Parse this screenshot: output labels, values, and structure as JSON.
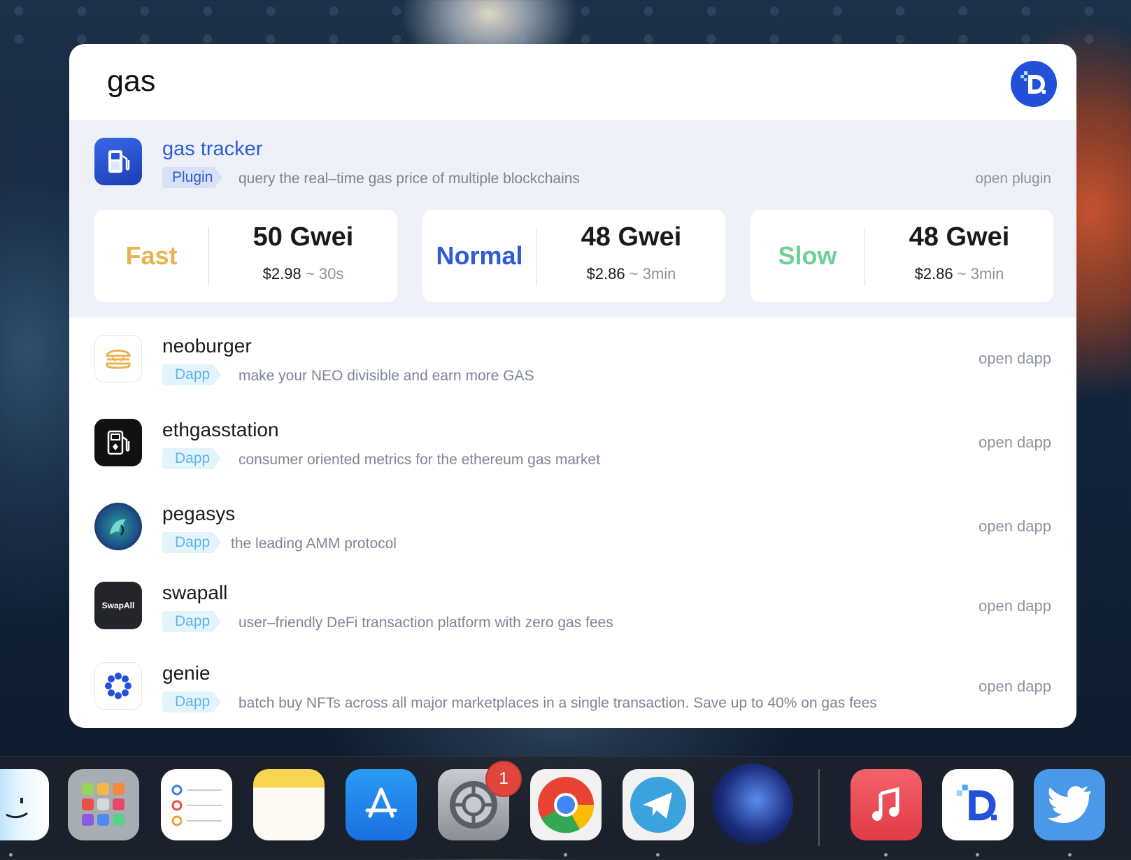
{
  "search": {
    "query": "gas"
  },
  "featured": {
    "title": "gas tracker",
    "badge": "Plugin",
    "description": "query the real–time gas price of multiple blockchains",
    "action": "open plugin",
    "cards": [
      {
        "speed": "Fast",
        "gwei": "50 Gwei",
        "price": "$2.98",
        "sep": "~",
        "time": "30s",
        "color": "#e8b252"
      },
      {
        "speed": "Normal",
        "gwei": "48 Gwei",
        "price": "$2.86",
        "sep": "~",
        "time": "3min",
        "color": "#2d5bd9"
      },
      {
        "speed": "Slow",
        "gwei": "48 Gwei",
        "price": "$2.86",
        "sep": "~",
        "time": "3min",
        "color": "#6fcf97"
      }
    ]
  },
  "results": [
    {
      "title": "neoburger",
      "badge": "Dapp",
      "description": "make your NEO divisible and earn more GAS",
      "action": "open dapp",
      "icon": "burger-icon"
    },
    {
      "title": "ethgasstation",
      "badge": "Dapp",
      "description": "consumer oriented metrics for the ethereum gas market",
      "action": "open dapp",
      "icon": "gas-pump-icon"
    },
    {
      "title": "pegasys",
      "badge": "Dapp",
      "description": "the leading AMM protocol",
      "action": "open dapp",
      "icon": "pegasus-icon"
    },
    {
      "title": "swapall",
      "badge": "Dapp",
      "description": "user–friendly DeFi transaction platform with zero gas fees",
      "action": "open dapp",
      "icon": "swapall-logo",
      "icon_text": "SwapAll"
    },
    {
      "title": "genie",
      "badge": "Dapp",
      "description": "batch buy NFTs across all major marketplaces in a single transaction. Save up to 40% on gas fees",
      "action": "open dapp",
      "icon": "genie-icon"
    }
  ],
  "dock": {
    "apps": [
      "finder",
      "launchpad",
      "reminders",
      "notes",
      "app-store",
      "system-preferences",
      "chrome",
      "telegram",
      "cinema4d",
      "music",
      "dapp-launcher",
      "twitter"
    ],
    "settings_badge": "1"
  },
  "colors": {
    "accent": "#2d5bd9",
    "fast": "#e8b252",
    "slow": "#6fcf97",
    "dapp_badge": "#5fb4e6"
  }
}
